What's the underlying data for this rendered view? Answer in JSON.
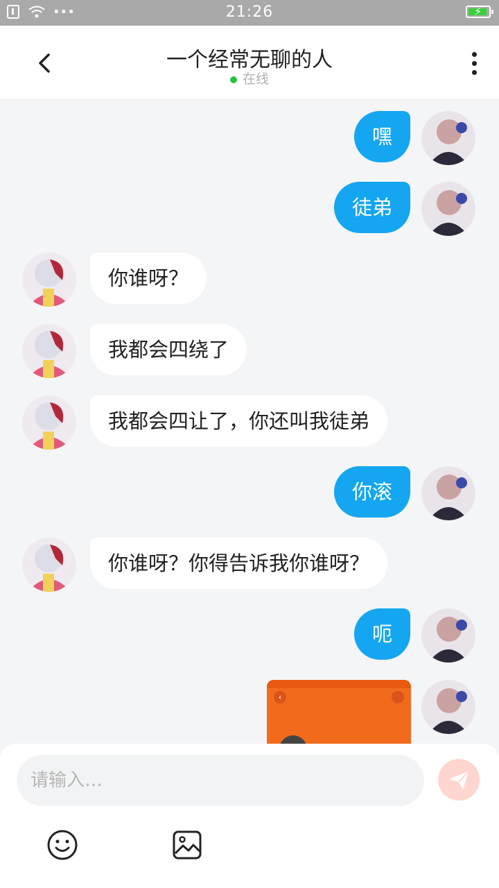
{
  "status_bar": {
    "time": "21:26"
  },
  "header": {
    "title": "一个经常无聊的人",
    "status": "在线"
  },
  "messages": [
    {
      "side": "right",
      "text": "嘿"
    },
    {
      "side": "right",
      "text": "徒弟"
    },
    {
      "side": "left",
      "text": "你谁呀？"
    },
    {
      "side": "left",
      "text": "我都会四绕了"
    },
    {
      "side": "left",
      "text": "我都会四让了，你还叫我徒弟"
    },
    {
      "side": "right",
      "text": "你滚"
    },
    {
      "side": "left",
      "text": "你谁呀？你得告诉我你谁呀？"
    },
    {
      "side": "right",
      "text": "呃"
    },
    {
      "side": "right",
      "type": "image"
    }
  ],
  "composer": {
    "placeholder": "请输入…"
  },
  "colors": {
    "my_bubble": "#14a6f0",
    "their_bubble": "#ffffff",
    "online_dot": "#23c343",
    "send_button": "#ffd6cf"
  },
  "icons": [
    "back-arrow-icon",
    "more-vertical-icon",
    "send-icon",
    "emoji-icon",
    "image-icon",
    "wifi-icon",
    "battery-charging-icon"
  ]
}
